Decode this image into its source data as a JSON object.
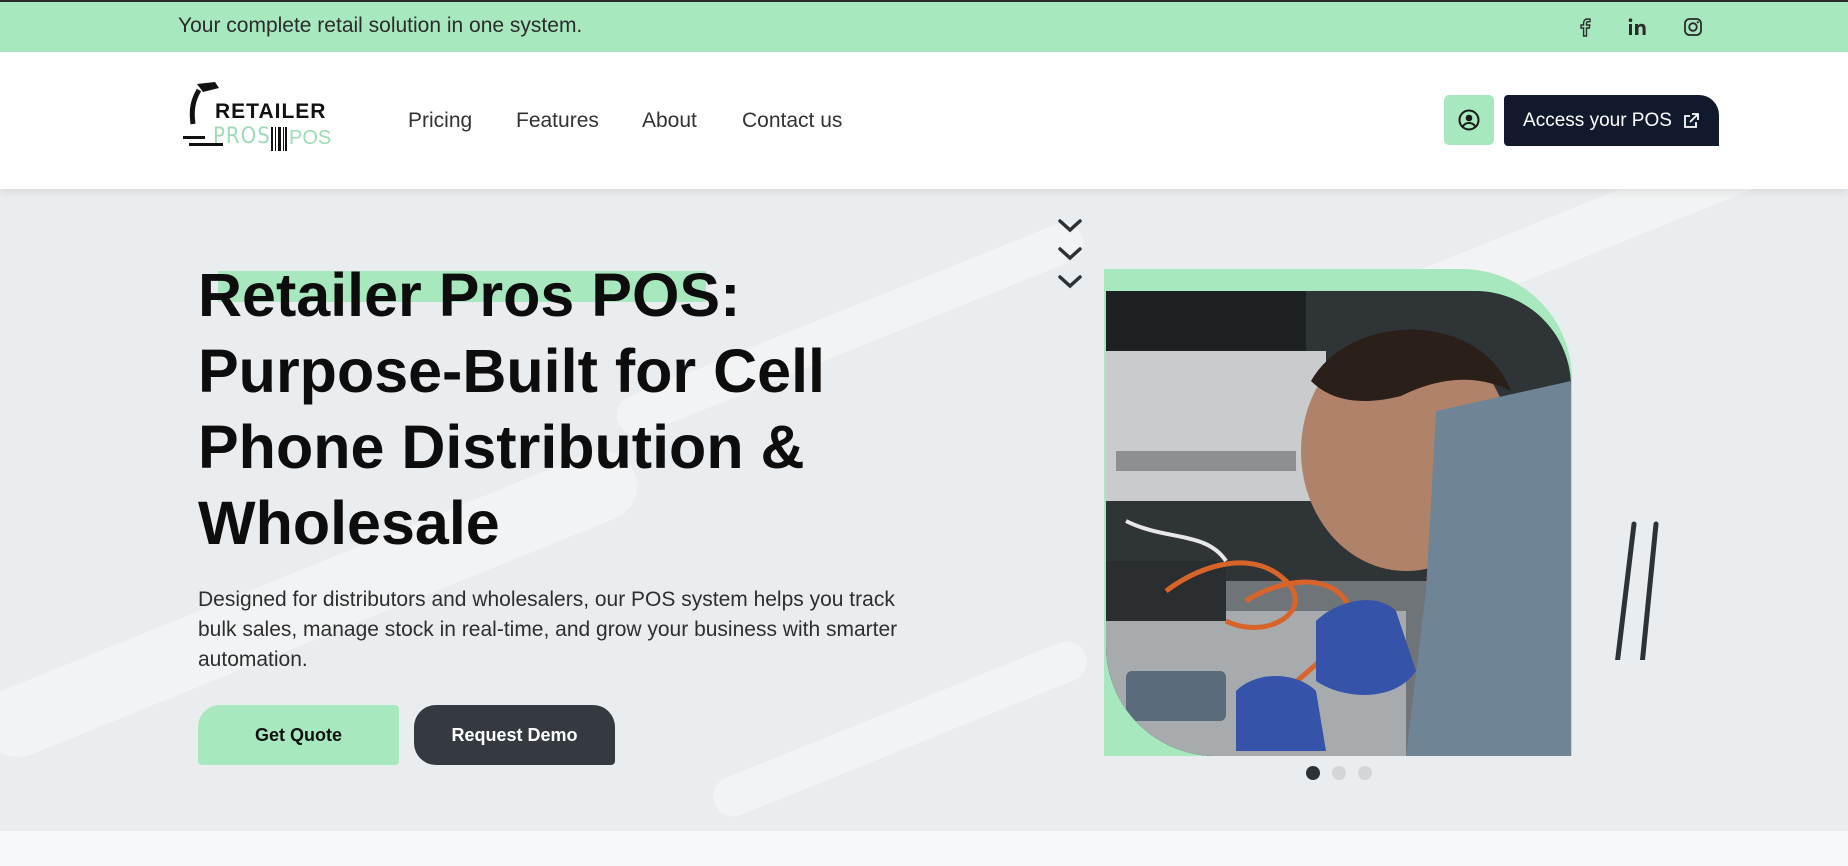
{
  "topbar": {
    "tagline": "Your complete retail solution in one system.",
    "social": [
      {
        "name": "facebook-icon",
        "glyph": "f"
      },
      {
        "name": "linkedin-icon",
        "glyph": "in"
      },
      {
        "name": "instagram-icon",
        "glyph": "ig"
      }
    ]
  },
  "header": {
    "logo": {
      "line1": "RETAILER",
      "line2": "PROS",
      "line3": "POS"
    },
    "nav": [
      "Pricing",
      "Features",
      "About",
      "Contact us"
    ],
    "user_icon": "user-circle-icon",
    "access_label": "Access your POS",
    "access_icon": "external-link-icon"
  },
  "hero": {
    "title_lines": [
      "Retailer Pros POS:",
      "Purpose-Built for Cell",
      "Phone Distribution &",
      "Wholesale"
    ],
    "description": "Designed for distributors and wholesalers, our POS system helps you track bulk sales, manage stock in real-time, and grow your business with smarter automation.",
    "quote_label": "Get Quote",
    "demo_label": "Request Demo",
    "carousel": {
      "slides": 3,
      "active": 1
    }
  },
  "colors": {
    "accent_green": "#a8e8bf",
    "navy": "#111a2c",
    "dark_button": "#343a40",
    "hero_bg": "#eaedef"
  }
}
